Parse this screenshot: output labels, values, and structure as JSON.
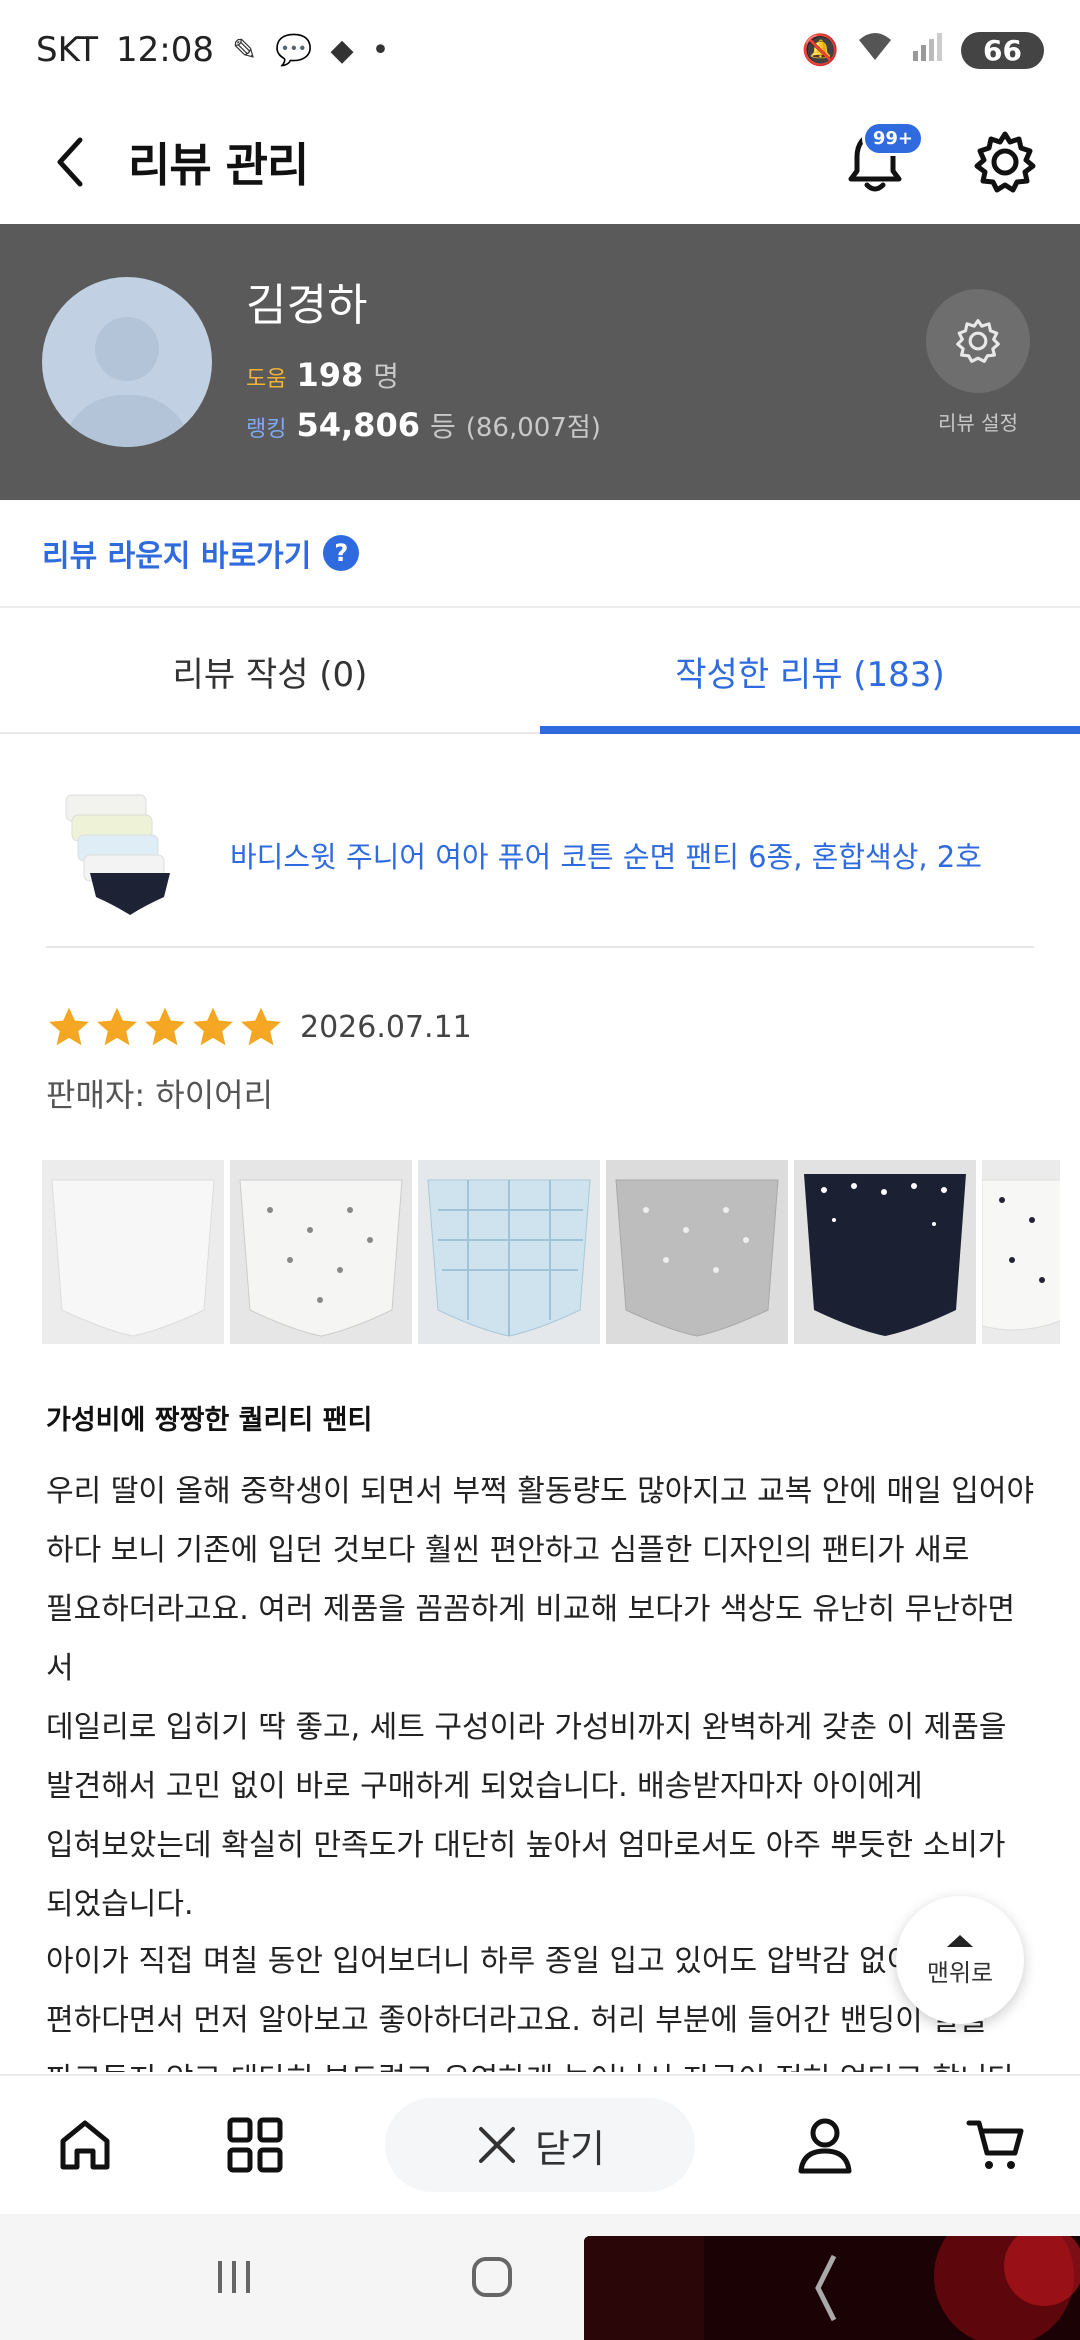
{
  "status_bar": {
    "carrier": "SKT",
    "time": "12:08",
    "dot": "•",
    "battery": "66"
  },
  "header": {
    "title": "리뷰 관리",
    "notification_badge": "99+"
  },
  "profile": {
    "name": "김경하",
    "help_label": "도움",
    "help_count": "198",
    "help_unit": "명",
    "rank_label": "랭킹",
    "rank_value": "54,806",
    "rank_unit": "등",
    "rank_points": "(86,007점)",
    "settings_label": "리뷰 설정"
  },
  "lounge": {
    "label": "리뷰 라운지 바로가기",
    "help": "?"
  },
  "tabs": [
    {
      "label": "리뷰 작성 (0)",
      "active": false
    },
    {
      "label": "작성한 리뷰 (183)",
      "active": true
    }
  ],
  "product": {
    "name": "바디스윗 주니어 여아 퓨어 코튼 순면 팬티 6종, 혼합색상, 2호"
  },
  "review": {
    "rating": 5,
    "date": "2026.07.11",
    "seller": "판매자: 하이어리",
    "title": "가성비에 짱짱한 퀄리티 팬티",
    "body_p1_lines": [
      "우리 딸이 올해 중학생이 되면서 부쩍 활동량도 많아지고 교복 안에 매일 입어야",
      "하다 보니 기존에 입던 것보다 훨씬 편안하고 심플한 디자인의 팬티가 새로",
      "필요하더라고요. 여러 제품을 꼼꼼하게 비교해 보다가 색상도 유난히 무난하면서",
      "데일리로 입히기 딱 좋고, 세트 구성이라 가성비까지 완벽하게 갖춘 이 제품을",
      "발견해서 고민 없이 바로 구매하게 되었습니다. 배송받자마자 아이에게",
      "입혀보았는데 확실히 만족도가 대단히 높아서 엄마로서도 아주 뿌듯한 소비가",
      "되었습니다."
    ],
    "body_p2_lines": [
      "아이가 직접 며칠 동안 입어보더니 하루 종일 입고 있어도 압박감 없이 정말",
      "편하다면서 먼저 알아보고 좋아하더라고요. 허리 부분에 들어간 밴딩이 살을",
      "파고들지 않고 대단히 부드럽고 유연하게 늘어나서 자국이 전혀 없다고 합니다."
    ]
  },
  "to_top_label": "맨위로",
  "bottom_nav": {
    "close_label": "닫기"
  },
  "colors": {
    "accent": "#2f6bdf",
    "profile_bg": "#5a5a5a",
    "star": "#f5a623"
  },
  "icons": [
    "back-arrow-icon",
    "bell-icon",
    "gear-icon",
    "home-icon",
    "grid-icon",
    "close-icon",
    "user-icon",
    "cart-icon"
  ]
}
